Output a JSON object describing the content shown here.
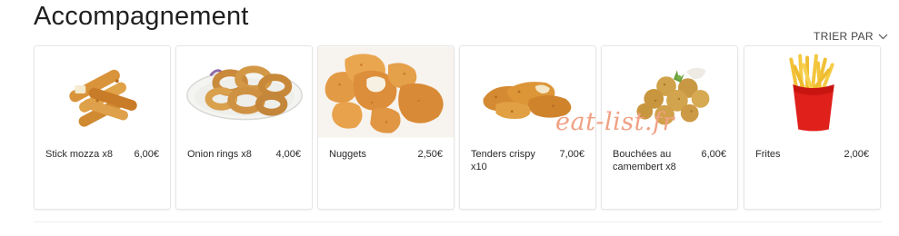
{
  "section": {
    "title": "Accompagnement",
    "sort_label": "TRIER PAR",
    "sort_icon": "chevron-down-icon"
  },
  "products": [
    {
      "name": "Stick mozza x8",
      "price": "6,00€",
      "image": "mozzarella-sticks"
    },
    {
      "name": "Onion rings x8",
      "price": "4,00€",
      "image": "onion-rings"
    },
    {
      "name": "Nuggets",
      "price": "2,50€",
      "image": "nuggets"
    },
    {
      "name": "Tenders crispy x10",
      "price": "7,00€",
      "image": "chicken-tenders"
    },
    {
      "name": "Bouchées au camembert x8",
      "price": "6,00€",
      "image": "camembert-bites"
    },
    {
      "name": "Frites",
      "price": "2,00€",
      "image": "french-fries"
    }
  ],
  "watermark": "eat-list.fr",
  "colors": {
    "watermark": "#f0a184",
    "fries_box": "#e0201b",
    "fried_golden": "#d99238"
  }
}
